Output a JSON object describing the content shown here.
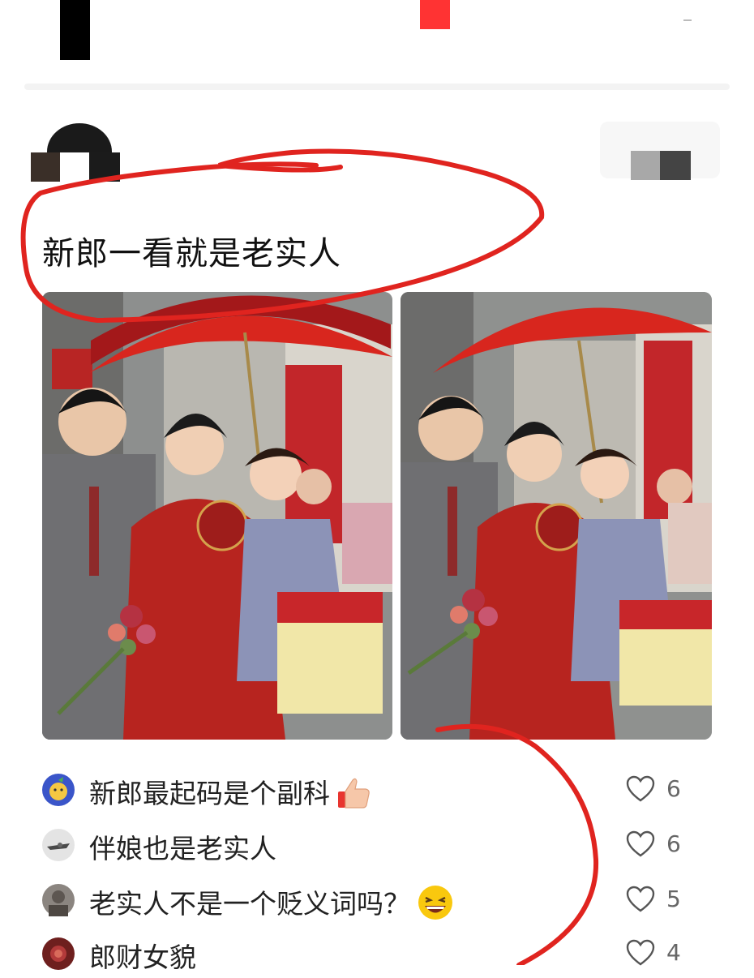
{
  "post": {
    "title": "新郎一看就是老实人"
  },
  "comments": [
    {
      "text": "新郎最起码是个副科",
      "emoji": "thumbs-up-icon",
      "likes": "6"
    },
    {
      "text": "伴娘也是老实人",
      "emoji": "",
      "likes": "6"
    },
    {
      "text": "老实人不是一个贬义词吗？",
      "emoji": "laughing-face-icon",
      "likes": "5"
    },
    {
      "text": "郎财女貌",
      "emoji": "",
      "likes": "4"
    }
  ],
  "colors": {
    "annotation": "#e0241f",
    "umbrella": "#d8261e",
    "heart_outline": "#555555"
  }
}
